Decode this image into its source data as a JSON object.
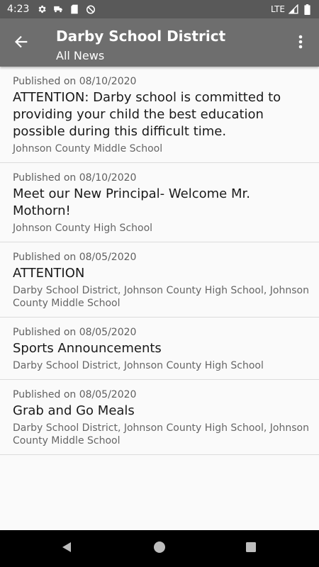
{
  "status_bar": {
    "time": "4:23",
    "network": "LTE",
    "icons": [
      "gear-icon",
      "truck-icon",
      "sd-card-icon",
      "no-sync-icon",
      "signal-icon",
      "battery-icon"
    ]
  },
  "app_bar": {
    "title": "Darby School District",
    "subtitle": "All News",
    "back_icon": "back-arrow-icon",
    "menu_icon": "overflow-menu-icon"
  },
  "news": [
    {
      "date": "Published on 08/10/2020",
      "title": "ATTENTION: Darby school is committed to providing your child the best education possible during this difficult time.",
      "schools": "Johnson County Middle School"
    },
    {
      "date": "Published on 08/10/2020",
      "title": "Meet our New Principal- Welcome Mr. Mothorn!",
      "schools": "Johnson County High School"
    },
    {
      "date": "Published on 08/05/2020",
      "title": "ATTENTION",
      "schools": "Darby School District, Johnson County High School, Johnson County Middle School"
    },
    {
      "date": "Published on 08/05/2020",
      "title": "Sports Announcements",
      "schools": "Darby School District, Johnson County High School"
    },
    {
      "date": "Published on 08/05/2020",
      "title": "Grab and Go Meals",
      "schools": "Darby School District, Johnson County High School, Johnson County Middle School"
    }
  ],
  "nav_bar": {
    "icons": [
      "back-triangle-icon",
      "home-circle-icon",
      "recents-square-icon"
    ]
  },
  "colors": {
    "status_bar": "#595959",
    "app_bar": "#6e6e6e",
    "background": "#fafafa",
    "nav_bar": "#000000"
  }
}
